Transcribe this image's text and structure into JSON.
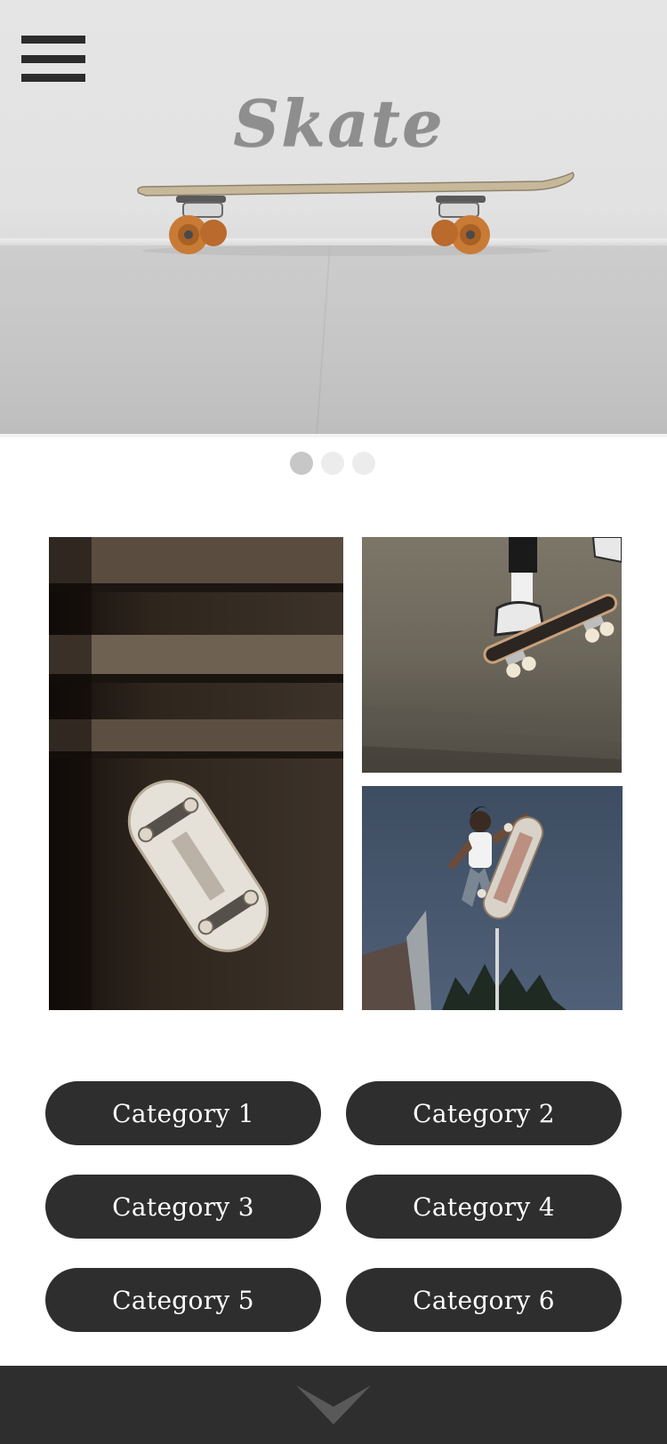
{
  "hero": {
    "brand": "Skate",
    "menu_icon": "hamburger-menu-icon",
    "image": "skateboard-on-floor-photo"
  },
  "carousel": {
    "slide_count": 3,
    "active_index": 0
  },
  "gallery": {
    "images": [
      "skateboard-on-stairs-photo",
      "skater-feet-on-board-photo",
      "skater-jumping-photo"
    ]
  },
  "categories": [
    {
      "label": "Category 1"
    },
    {
      "label": "Category 2"
    },
    {
      "label": "Category 3"
    },
    {
      "label": "Category 4"
    },
    {
      "label": "Category 5"
    },
    {
      "label": "Category 6"
    }
  ],
  "footer": {
    "icon": "chevron-down-icon"
  },
  "colors": {
    "button_bg": "#2e2e2e",
    "footer_bg": "#2e2e2e",
    "dot_active": "#c7c7c7",
    "dot_inactive": "#ececec"
  }
}
